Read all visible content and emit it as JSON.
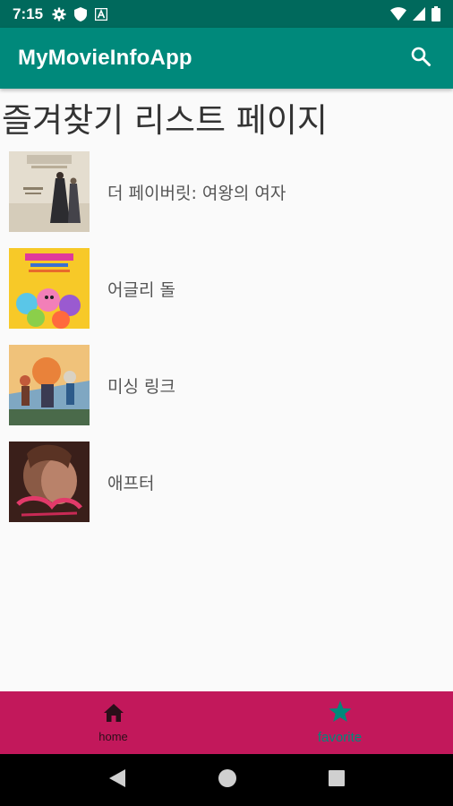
{
  "status_bar": {
    "time": "7:15",
    "left_icons": [
      "gear-icon",
      "shield-icon",
      "a-icon"
    ],
    "right_icons": [
      "wifi-icon",
      "signal-icon",
      "battery-icon"
    ]
  },
  "app_bar": {
    "title": "MyMovieInfoApp",
    "action_icon": "search-icon",
    "color": "#00897b"
  },
  "page": {
    "title": "즐겨찾기 리스트 페이지"
  },
  "movies": [
    {
      "title": "더 페이버릿: 여왕의 여자"
    },
    {
      "title": "어글리 돌"
    },
    {
      "title": "미싱 링크"
    },
    {
      "title": "애프터"
    }
  ],
  "bottom_nav": {
    "color": "#c2185b",
    "items": [
      {
        "label": "home",
        "icon": "home-icon",
        "active": false
      },
      {
        "label": "favorite",
        "icon": "star-icon",
        "active": true
      }
    ]
  },
  "system_nav": {
    "buttons": [
      "back-icon",
      "home-circle-icon",
      "recents-square-icon"
    ]
  }
}
